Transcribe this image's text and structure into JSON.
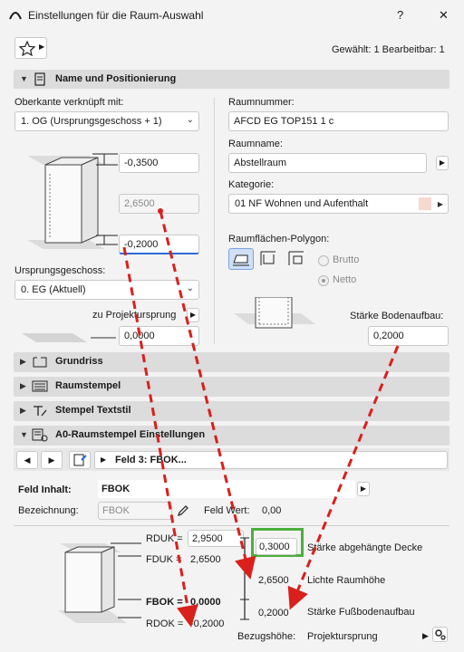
{
  "window": {
    "title": "Einstellungen für die Raum-Auswahl",
    "help": "?",
    "close": "✕"
  },
  "header": {
    "selection_info": "Gewählt: 1 Bearbeitbar: 1"
  },
  "section_name": {
    "label": "Name und Positionierung"
  },
  "left": {
    "top_link_label": "Oberkante verknüpft mit:",
    "top_link_value": "1. OG (Ursprungsgeschoss + 1)",
    "top_offset": "-0,3500",
    "height": "2,6500",
    "bottom_offset": "-0,2000",
    "origin_story_label": "Ursprungsgeschoss:",
    "origin_story_value": "0. EG (Aktuell)",
    "project_zero_label": "zu Projektursprung",
    "project_zero_value": "0,0000"
  },
  "right": {
    "room_number_label": "Raumnummer:",
    "room_number_value": "AFCD EG TOP151 1 c",
    "room_name_label": "Raumname:",
    "room_name_value": "Abstellraum",
    "category_label": "Kategorie:",
    "category_value": "01 NF  Wohnen und Aufenthalt",
    "category_color": "#f6d9cf",
    "polygon_label": "Raumflächen-Polygon:",
    "radio_brutto": "Brutto",
    "radio_netto": "Netto",
    "floor_thickness_label": "Stärke Bodenaufbau:",
    "floor_thickness_value": "0,2000"
  },
  "sections": [
    {
      "label": "Grundriss"
    },
    {
      "label": "Raumstempel"
    },
    {
      "label": "Stempel Textstil"
    },
    {
      "label": "A0-Raumstempel Einstellungen"
    }
  ],
  "stamp": {
    "field_selector": "Feld 3: FBOK...",
    "field_content_label": "Feld Inhalt:",
    "field_content_value": "FBOK",
    "designation_label": "Bezeichnung:",
    "designation_value": "FBOK",
    "field_value_label": "Feld Wert:",
    "field_value": "0,00",
    "rduk_label": "RDUK =",
    "rduk_value": "2,9500",
    "fduk_label": "FDUK =",
    "fduk_value": "2,6500",
    "fbok_label": "FBOK =",
    "fbok_value": "0,0000",
    "rdok_label": "RDOK =",
    "rdok_value": "-0,2000",
    "suspended_ceiling_value": "0,3000",
    "suspended_ceiling_label": "Stärke abgehängte Decke",
    "clear_height_value": "2,6500",
    "clear_height_label": "Lichte Raumhöhe",
    "floor_build_value": "0,2000",
    "floor_build_label": "Stärke Fußbodenaufbau",
    "reference_height_label": "Bezugshöhe:",
    "reference_height_value": "Projektursprung"
  },
  "colors": {
    "annotation_red": "#d9201c",
    "highlight_green": "#4caf3c",
    "focus_blue": "#2a6bd6"
  }
}
